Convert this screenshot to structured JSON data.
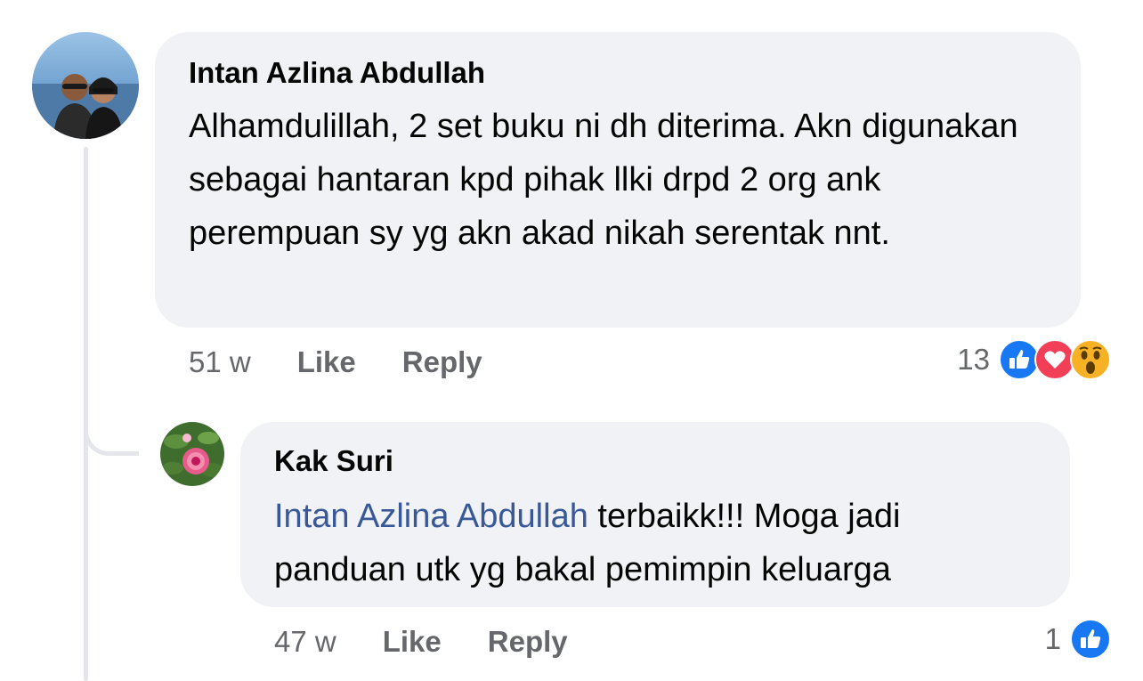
{
  "comments": [
    {
      "author": "Intan Azlina Abdullah",
      "text": "Alhamdulillah, 2 set buku ni dh diterima. Akn digunakan sebagai hantaran kpd pihak llki drpd 2 org ank perempuan sy yg akn akad nikah serentak nnt.",
      "time": "51 w",
      "like_label": "Like",
      "reply_label": "Reply",
      "reaction_count": "13",
      "reactions": [
        "like-icon",
        "love-icon",
        "wow-icon"
      ]
    },
    {
      "author": "Kak Suri",
      "mention": "Intan Azlina Abdullah",
      "text": " terbaikk!!! Moga jadi panduan utk yg bakal  pemimpin keluarga",
      "time": "47 w",
      "like_label": "Like",
      "reply_label": "Reply",
      "reaction_count": "1",
      "reactions": [
        "like-icon"
      ]
    }
  ],
  "colors": {
    "bubble": "#f0f2f5",
    "meta_text": "#65676b",
    "mention": "#385898",
    "like": "#1877f2",
    "love": "#f33e58",
    "wow": "#f7b125"
  }
}
